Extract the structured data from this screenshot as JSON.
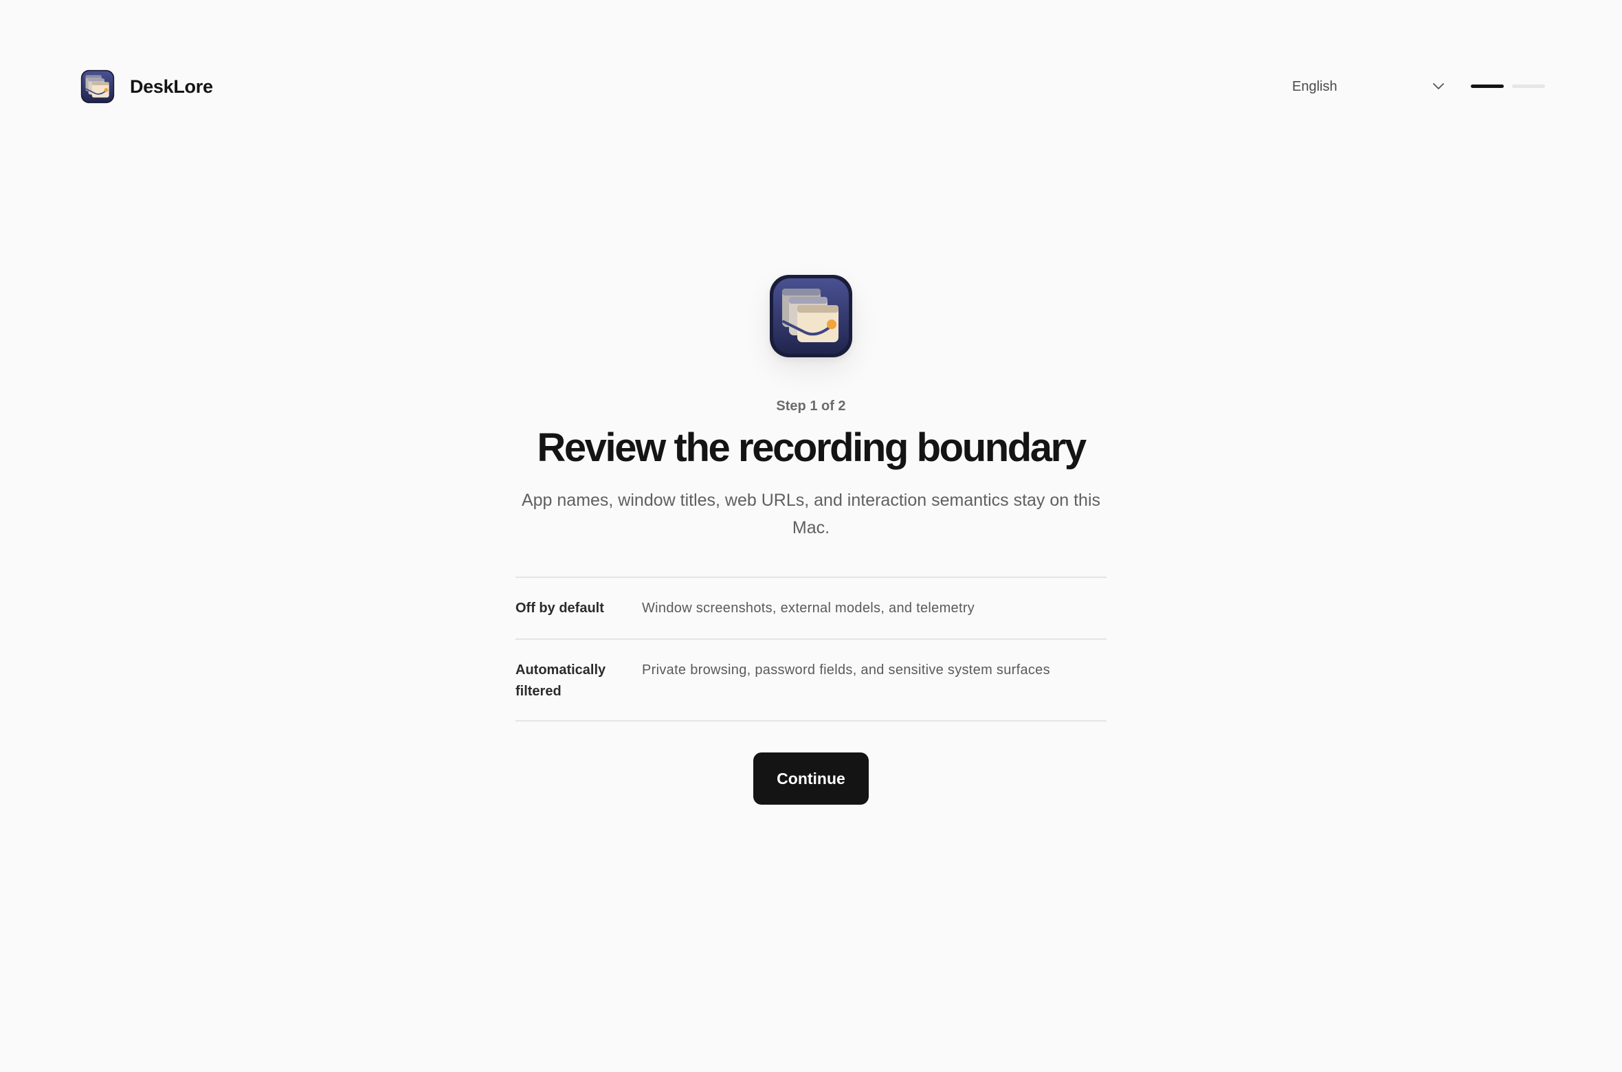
{
  "header": {
    "brand_name": "DeskLore",
    "brand_icon": "desklore-app-icon",
    "language": {
      "selected": "English",
      "icon": "chevron-down-icon"
    },
    "progress": {
      "current_step": 1,
      "total_steps": 2
    }
  },
  "main": {
    "hero_icon": "desklore-app-icon",
    "step_label": "Step 1 of 2",
    "title": "Review the recording boundary",
    "subtitle": "App names, window titles, web URLs, and interaction semantics stay on this Mac.",
    "policy": [
      {
        "key": "Off by default",
        "value": "Window screenshots, external models, and telemetry"
      },
      {
        "key": "Automatically filtered",
        "value": "Private browsing, password fields, and sensitive system surfaces"
      }
    ],
    "continue_label": "Continue"
  },
  "colors": {
    "background": "#fafafa",
    "primary": "#141414",
    "icon_bg": "#2b3163",
    "progress_inactive": "#e6e6e6"
  }
}
